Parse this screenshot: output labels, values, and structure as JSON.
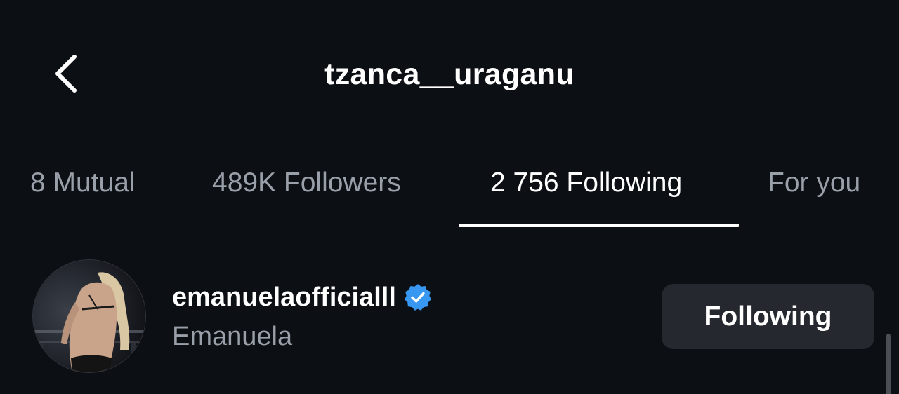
{
  "header": {
    "back_icon": "chevron-left-icon",
    "title": "tzanca__uraganu"
  },
  "tabs": [
    {
      "label": "8 Mutual",
      "active": false
    },
    {
      "label": "489K Followers",
      "active": false
    },
    {
      "label": "2 756 Following",
      "active": true
    },
    {
      "label": "For you",
      "active": false
    }
  ],
  "list": {
    "items": [
      {
        "username": "emanuelaofficialll",
        "full_name": "Emanuela",
        "verified": true,
        "verified_icon": "verified-badge-icon",
        "button_label": "Following"
      }
    ]
  },
  "colors": {
    "background": "#0c0f14",
    "text_primary": "#ffffff",
    "text_secondary": "#9aa0a9",
    "button_bg": "#25292f",
    "verified_blue": "#3897f0",
    "divider": "#262a31"
  }
}
